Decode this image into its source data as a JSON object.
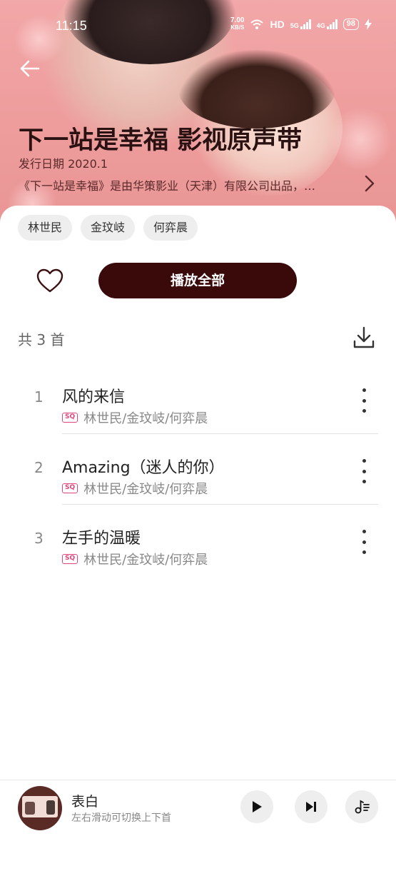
{
  "status_bar": {
    "time": "11:15",
    "net_speed_value": "7.00",
    "net_speed_unit": "KB/S",
    "hd_label": "HD",
    "sim1_label": "5G",
    "sim2_label": "4G",
    "battery": "98"
  },
  "album": {
    "title": "下一站是幸福 影视原声带",
    "release_date": "发行日期 2020.1",
    "description": "《下一站是幸福》是由华策影业（天津）有限公司出品，…"
  },
  "artists": [
    "林世民",
    "金玟岐",
    "何弈晨"
  ],
  "actions": {
    "play_all_label": "播放全部"
  },
  "count_label": "共 3 首",
  "songs": [
    {
      "number": "1",
      "title": "风的来信",
      "quality": "SQ",
      "artists": "林世民/金玟岐/何弈晨"
    },
    {
      "number": "2",
      "title": "Amazing（迷人的你）",
      "quality": "SQ",
      "artists": "林世民/金玟岐/何弈晨"
    },
    {
      "number": "3",
      "title": "左手的温暖",
      "quality": "SQ",
      "artists": "林世民/金玟岐/何弈晨"
    }
  ],
  "player": {
    "title": "表白",
    "subtitle": "左右滑动可切换上下首"
  },
  "icons": {
    "back": "back-arrow-icon",
    "more_desc": "chevron-right-icon",
    "like": "heart-icon",
    "download": "download-icon",
    "song_more": "more-vertical-icon",
    "play": "play-icon",
    "next": "skip-next-icon",
    "queue": "playlist-icon"
  },
  "colors": {
    "header_bg": "#ee9c9c",
    "play_all_bg": "#3a0a0a",
    "sq_badge": "#e0457a"
  }
}
